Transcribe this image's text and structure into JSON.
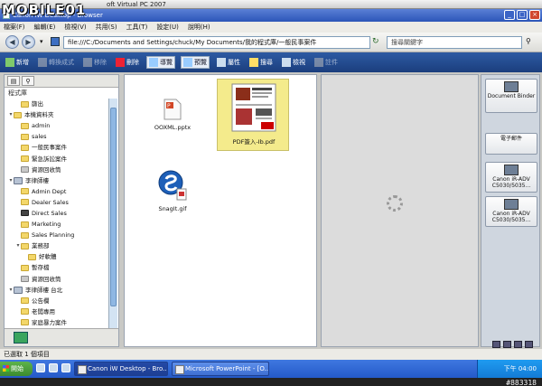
{
  "vpc_title": "oft Virtual PC 2007",
  "logo": "MOBILE01",
  "app": {
    "title": "Canon iW Desktop - Browser"
  },
  "menu": [
    "檔案(F)",
    "編輯(E)",
    "檢視(V)",
    "共用(S)",
    "工具(T)",
    "設定(U)",
    "說明(H)"
  ],
  "address": {
    "path": "file:///C:/Documents and Settings/chuck/My Documents/我的程式庫/一般民事案件",
    "search_placeholder": "搜尋關鍵字"
  },
  "toolbar": [
    {
      "label": "新增",
      "state": "normal"
    },
    {
      "label": "轉換成式",
      "state": "dim"
    },
    {
      "label": "移除",
      "state": "dim"
    },
    {
      "label": "刪除",
      "state": "normal"
    },
    {
      "label": "導覽",
      "state": "active"
    },
    {
      "label": "預覽",
      "state": "active"
    },
    {
      "label": "屬性",
      "state": "normal"
    },
    {
      "label": "搜尋",
      "state": "normal"
    },
    {
      "label": "檢視",
      "state": "normal"
    },
    {
      "label": "註件",
      "state": "dim"
    }
  ],
  "library": {
    "title": "程式庫",
    "items": [
      {
        "label": "篩出",
        "indent": 1,
        "type": "folder",
        "twisty": ""
      },
      {
        "label": "本機資料夾",
        "indent": 0,
        "type": "folder",
        "twisty": "▾"
      },
      {
        "label": "admin",
        "indent": 1,
        "type": "folder",
        "twisty": ""
      },
      {
        "label": "sales",
        "indent": 1,
        "type": "folder",
        "twisty": ""
      },
      {
        "label": "一般民事案件",
        "indent": 1,
        "type": "folder",
        "twisty": ""
      },
      {
        "label": "緊急訴訟案件",
        "indent": 1,
        "type": "folder",
        "twisty": ""
      },
      {
        "label": "資源回收筒",
        "indent": 1,
        "type": "gray",
        "twisty": ""
      },
      {
        "label": "李律師樓",
        "indent": 0,
        "type": "server",
        "twisty": "▾"
      },
      {
        "label": "Admin Dept",
        "indent": 1,
        "type": "folder",
        "twisty": ""
      },
      {
        "label": "Dealer Sales",
        "indent": 1,
        "type": "folder",
        "twisty": ""
      },
      {
        "label": "Direct Sales",
        "indent": 1,
        "type": "dark",
        "twisty": ""
      },
      {
        "label": "Marketing",
        "indent": 1,
        "type": "folder",
        "twisty": ""
      },
      {
        "label": "Sales Planning",
        "indent": 1,
        "type": "folder",
        "twisty": ""
      },
      {
        "label": "業務部",
        "indent": 1,
        "type": "folder",
        "twisty": "▾"
      },
      {
        "label": "好軟體",
        "indent": 2,
        "type": "folder",
        "twisty": ""
      },
      {
        "label": "暫存檔",
        "indent": 1,
        "type": "folder",
        "twisty": ""
      },
      {
        "label": "資源回收筒",
        "indent": 1,
        "type": "gray",
        "twisty": ""
      },
      {
        "label": "李律師樓 台北",
        "indent": 0,
        "type": "server",
        "twisty": "▾"
      },
      {
        "label": "公告欄",
        "indent": 1,
        "type": "folder",
        "twisty": ""
      },
      {
        "label": "老闆專用",
        "indent": 1,
        "type": "folder",
        "twisty": ""
      },
      {
        "label": "家庭暴力案件",
        "indent": 1,
        "type": "folder",
        "twisty": ""
      }
    ]
  },
  "files": [
    {
      "name": "OOXML.pptx",
      "selected": false
    },
    {
      "name": "PDF簽入-Ib.pdf",
      "selected": true
    },
    {
      "name": "SnagIt.gif",
      "selected": false
    }
  ],
  "right_panel": [
    {
      "label": "Document Binder"
    },
    {
      "label": "電子郵件"
    },
    {
      "label": "Canon iR-ADV C5030/5035..."
    },
    {
      "label": "Canon iR-ADV C5030/5035..."
    }
  ],
  "status": {
    "text": "已選取 1 個項目"
  },
  "taskbar": {
    "start": "開始",
    "tasks": [
      "Canon iW Desktop - Bro...",
      "Microsoft PowerPoint - [O..."
    ],
    "clock": "下午 04:00"
  },
  "watermark": "#883318",
  "colors": {
    "toolbar": "#1b3e7d",
    "selection": "#f4eb8c",
    "titlebar": "#2c55b8"
  }
}
